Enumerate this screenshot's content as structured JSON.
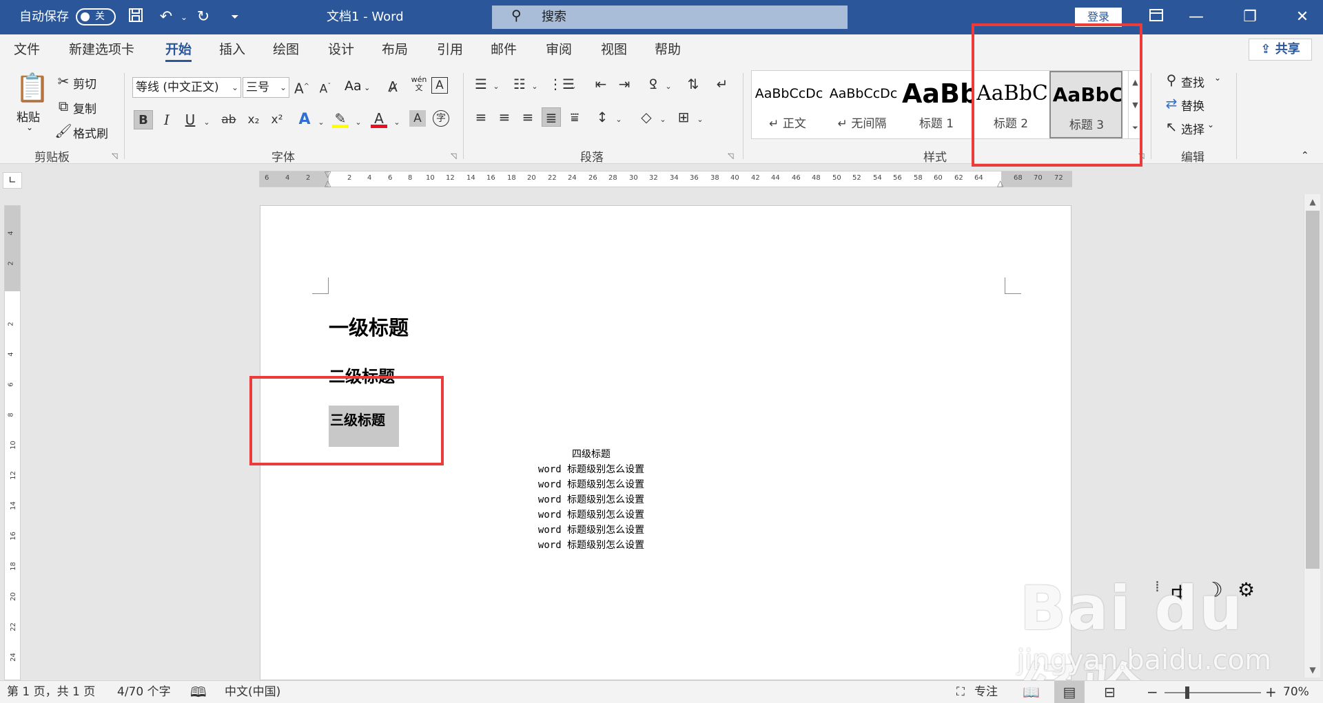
{
  "titlebar": {
    "autosave_label": "自动保存",
    "autosave_state": "关",
    "doc_title": "文档1  -  Word",
    "search_placeholder": "搜索",
    "signin_label": "登录"
  },
  "tabs": [
    "文件",
    "新建选项卡",
    "开始",
    "插入",
    "绘图",
    "设计",
    "布局",
    "引用",
    "邮件",
    "审阅",
    "视图",
    "帮助"
  ],
  "active_tab": "开始",
  "share_label": "共享",
  "ribbon": {
    "clipboard": {
      "label": "剪贴板",
      "paste": "粘贴",
      "cut": "剪切",
      "copy": "复制",
      "format_painter": "格式刷"
    },
    "font": {
      "label": "字体",
      "font_name": "等线 (中文正文)",
      "font_size": "三号",
      "change_case": "Aa",
      "bold": "B",
      "italic": "I",
      "underline": "U",
      "strike": "ab",
      "subscript": "x₂",
      "superscript": "x²",
      "phonetic": "wén",
      "phonetic_char": "文",
      "char_border": "A",
      "enclose": "字"
    },
    "paragraph": {
      "label": "段落"
    },
    "styles": {
      "label": "样式",
      "items": [
        {
          "sample": "AaBbCcDc",
          "name": "↵ 正文"
        },
        {
          "sample": "AaBbCcDc",
          "name": "↵ 无间隔"
        },
        {
          "sample": "AaBb",
          "name": "标题 1"
        },
        {
          "sample": "AaBbC",
          "name": "标题 2"
        },
        {
          "sample": "AaBbC",
          "name": "标题 3"
        }
      ],
      "selected": "标题 3"
    },
    "editing": {
      "label": "编辑",
      "find": "查找",
      "replace": "替换",
      "select": "选择"
    }
  },
  "ruler": {
    "left_numbers": [
      "6",
      "4",
      "2"
    ],
    "numbers": [
      "2",
      "4",
      "6",
      "8",
      "10",
      "12",
      "14",
      "16",
      "18",
      "20",
      "22",
      "24",
      "26",
      "28",
      "30",
      "32",
      "34",
      "36",
      "38",
      "40",
      "42",
      "44",
      "46",
      "48",
      "50",
      "52",
      "54",
      "56",
      "58",
      "60",
      "62",
      "64"
    ],
    "right_numbers": [
      "68",
      "70",
      "72"
    ],
    "vertical_numbers": [
      "4",
      "2",
      "2",
      "4",
      "6",
      "8",
      "10",
      "12",
      "14",
      "16",
      "18",
      "20",
      "22",
      "24"
    ]
  },
  "document": {
    "heading1": "一级标题",
    "heading2": "二级标题",
    "heading3": "三级标题",
    "heading4": "四级标题",
    "body_lines": [
      "word 标题级别怎么设置",
      "word 标题级别怎么设置",
      "word 标题级别怎么设置",
      "word 标题级别怎么设置",
      "word 标题级别怎么设置",
      "word 标题级别怎么设置"
    ]
  },
  "ime": {
    "mode": "中"
  },
  "watermark": {
    "brand": "Bai du 经验",
    "url": "jingyan.baidu.com"
  },
  "statusbar": {
    "page": "第 1 页，共 1 页",
    "words": "4/70 个字",
    "language": "中文(中国)",
    "focus": "专注",
    "zoom": "70%",
    "zoom_level": 0.7
  },
  "colors": {
    "titlebar": "#2b579a",
    "annotation": "#ec3b3b",
    "ribbon_bg": "#f3f3f3"
  }
}
